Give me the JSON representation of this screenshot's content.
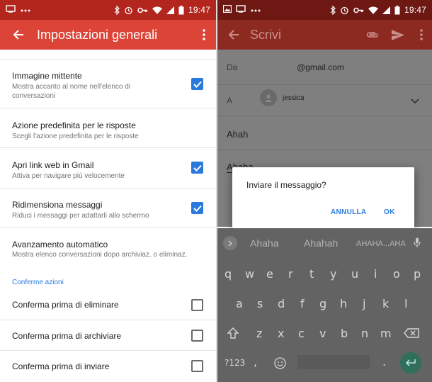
{
  "status_left": {
    "time": "19:47"
  },
  "status_right": {
    "time": "19:47"
  },
  "settings_screen": {
    "title": "Impostazioni generali",
    "rows": [
      {
        "title": "Immagine mittente",
        "subtitle": "Mostra accanto al nome nell'elenco di conversazioni",
        "checked": true
      },
      {
        "title": "Azione predefinita per le risposte",
        "subtitle": "Scegli l'azione predefinita per le risposte",
        "checked": null
      },
      {
        "title": "Apri link web in Gmail",
        "subtitle": "Attiva per navigare più velocemente",
        "checked": true
      },
      {
        "title": "Ridimensiona messaggi",
        "subtitle": "Riduci i messaggi per adattarli allo schermo",
        "checked": true
      },
      {
        "title": "Avanzamento automatico",
        "subtitle": "Mostra elenco conversazioni dopo archiviaz. o eliminaz.",
        "checked": null
      }
    ],
    "section_header": "Conferme azioni",
    "confirm_rows": [
      {
        "title": "Conferma prima di eliminare",
        "checked": false
      },
      {
        "title": "Conferma prima di archiviare",
        "checked": false
      },
      {
        "title": "Conferma prima di inviare",
        "checked": false
      }
    ]
  },
  "compose_screen": {
    "title": "Scrivi",
    "from_label": "Da",
    "from_value": "@gmail.com",
    "to_label": "A",
    "to_chip": "jessica",
    "subject": "Ahah",
    "body": "Ahaha"
  },
  "dialog": {
    "message": "Inviare il messaggio?",
    "cancel": "ANNULLA",
    "ok": "OK"
  },
  "keyboard": {
    "suggestions": [
      "Ahaha",
      "Ahahah",
      "AHAHA...AHA"
    ],
    "row1": [
      "q",
      "w",
      "e",
      "r",
      "t",
      "y",
      "u",
      "i",
      "o",
      "p"
    ],
    "row2": [
      "a",
      "s",
      "d",
      "f",
      "g",
      "h",
      "j",
      "k",
      "l"
    ],
    "row3": [
      "z",
      "x",
      "c",
      "v",
      "b",
      "n",
      "m"
    ],
    "symbols": "?123",
    "comma": ",",
    "period": "."
  },
  "colors": {
    "accent_red": "#db4437",
    "status_red": "#b3261e",
    "checkbox_blue": "#2a7ade"
  }
}
